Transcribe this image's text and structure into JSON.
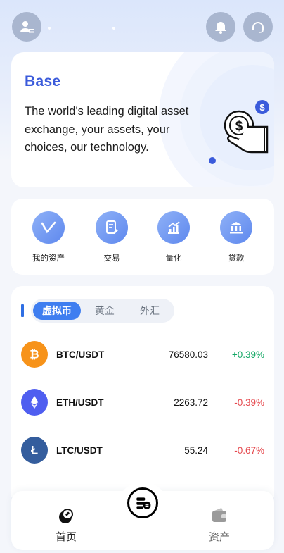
{
  "colors": {
    "accent": "#3b5bdb",
    "tab_active": "#3f7ef0",
    "up": "#12a764",
    "down": "#e5484d"
  },
  "header": {
    "profile_icon": "user-icon",
    "notification_icon": "bell-icon",
    "support_icon": "headset-icon"
  },
  "hero": {
    "title": "Base",
    "description": "The world's leading digital asset exchange, your assets, your choices, our technology."
  },
  "quick_actions": [
    {
      "label": "我的资产",
      "icon": "wallet-check-icon"
    },
    {
      "label": "交易",
      "icon": "document-edit-icon"
    },
    {
      "label": "量化",
      "icon": "chart-growth-icon"
    },
    {
      "label": "贷款",
      "icon": "bank-icon"
    }
  ],
  "market": {
    "tabs": [
      {
        "label": "虚拟币",
        "active": true
      },
      {
        "label": "黄金",
        "active": false
      },
      {
        "label": "外汇",
        "active": false
      }
    ],
    "rows": [
      {
        "pair": "BTC/USDT",
        "price": "76580.03",
        "change": "+0.39%",
        "direction": "up",
        "icon": "bitcoin-icon"
      },
      {
        "pair": "ETH/USDT",
        "price": "2263.72",
        "change": "-0.39%",
        "direction": "down",
        "icon": "ethereum-icon"
      },
      {
        "pair": "LTC/USDT",
        "price": "55.24",
        "change": "-0.67%",
        "direction": "down",
        "icon": "litecoin-icon"
      }
    ]
  },
  "bottom_nav": {
    "home_label": "首页",
    "assets_label": "资产",
    "center_icon": "trade-center-icon"
  }
}
